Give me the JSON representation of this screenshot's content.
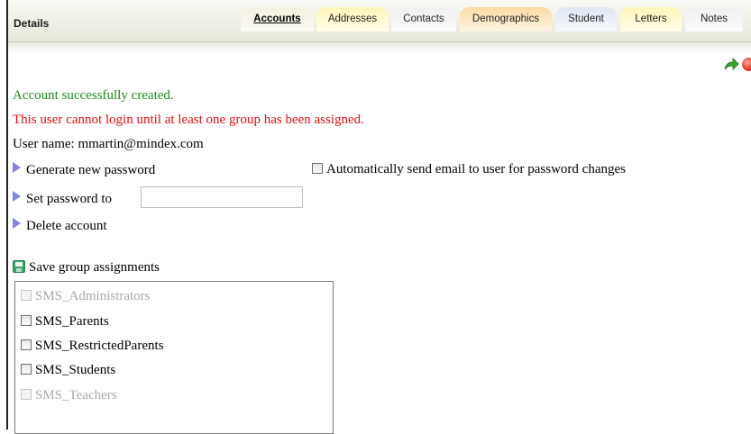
{
  "header": {
    "title": "Details",
    "tabs": [
      {
        "label": "Accounts",
        "color": "#f3f1df",
        "active": true
      },
      {
        "label": "Addresses",
        "color": "#fff6b8"
      },
      {
        "label": "Contacts",
        "color": "#f0f0f0"
      },
      {
        "label": "Demographics",
        "color": "#fbdba3"
      },
      {
        "label": "Student",
        "color": "#dfe7f3"
      },
      {
        "label": "Letters",
        "color": "#fff6b8"
      },
      {
        "label": "Notes",
        "color": "#f0f0f0"
      }
    ]
  },
  "toolbar": {
    "icons": [
      "green-arrow-icon",
      "red-stop-icon"
    ]
  },
  "messages": {
    "success": "Account successfully created.",
    "error": "This user cannot login until at least one group has been assigned.",
    "user_name": "User name: mmartin@mindex.com",
    "success_color": "#1e8a1e",
    "error_color": "#e01010"
  },
  "actions": {
    "generate_password": "Generate new password",
    "set_password": "Set password to",
    "set_password_value": "",
    "delete_account": "Delete account",
    "auto_email": "Automatically send email to user for password changes",
    "auto_email_checked": false
  },
  "groups": {
    "save_label": "Save group assignments",
    "items": [
      {
        "label": "SMS_Administrators",
        "disabled": true,
        "checked": false
      },
      {
        "label": "SMS_Parents",
        "disabled": false,
        "checked": false
      },
      {
        "label": "SMS_RestrictedParents",
        "disabled": false,
        "checked": false
      },
      {
        "label": "SMS_Students",
        "disabled": false,
        "checked": false
      },
      {
        "label": "SMS_Teachers",
        "disabled": true,
        "checked": false
      }
    ]
  }
}
